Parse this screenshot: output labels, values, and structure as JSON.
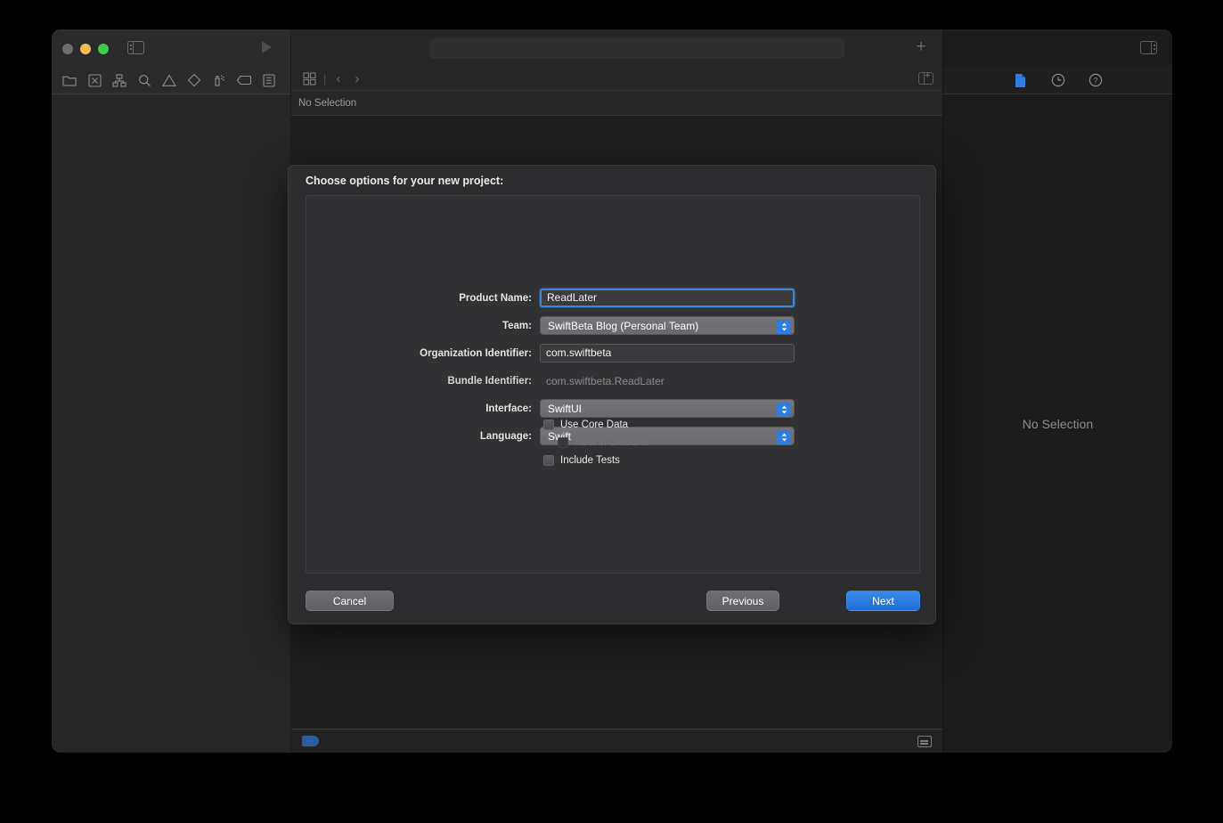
{
  "window": {
    "traffic_lights": [
      "close",
      "minimize",
      "maximize"
    ],
    "sidebar_toggle_icon": "sidebar-toggle-icon",
    "run_button_icon": "run-play-icon",
    "activity_field_value": "",
    "add_button_label": "+",
    "inspector_toggle_icon": "inspector-toggle-icon"
  },
  "navigator": {
    "tabs": [
      {
        "name": "project-navigator",
        "icon": "folder-icon"
      },
      {
        "name": "source-control-navigator",
        "icon": "x-box-icon"
      },
      {
        "name": "symbol-navigator",
        "icon": "hierarchy-icon"
      },
      {
        "name": "find-navigator",
        "icon": "search-icon"
      },
      {
        "name": "issue-navigator",
        "icon": "warning-triangle-icon"
      },
      {
        "name": "test-navigator",
        "icon": "diamond-icon"
      },
      {
        "name": "debug-navigator",
        "icon": "spray-icon"
      },
      {
        "name": "breakpoint-navigator",
        "icon": "tag-icon"
      },
      {
        "name": "report-navigator",
        "icon": "list-icon"
      }
    ]
  },
  "editor": {
    "jumpbar": {
      "grid_icon": "grid-icon",
      "separator": "|",
      "back_chevron": "‹",
      "forward_chevron": "›",
      "add_editor_icon": "add-editor-icon"
    },
    "no_selection_text": "No Selection"
  },
  "status_bar": {
    "tag_icon": "tag-badge-icon",
    "console_icon": "console-toggle-icon"
  },
  "inspector": {
    "tabs": [
      {
        "name": "file-inspector",
        "icon": "document-icon",
        "selected": true
      },
      {
        "name": "history-inspector",
        "icon": "clock-icon",
        "selected": false
      },
      {
        "name": "quick-help-inspector",
        "icon": "question-mark-icon",
        "selected": false
      }
    ],
    "empty_text": "No Selection"
  },
  "dialog": {
    "title": "Choose options for your new project:",
    "fields": [
      {
        "label": "Product Name:",
        "type": "text",
        "value": "ReadLater",
        "focused": true
      },
      {
        "label": "Team:",
        "type": "select",
        "value": "SwiftBeta Blog (Personal Team)"
      },
      {
        "label": "Organization Identifier:",
        "type": "text",
        "value": "com.swiftbeta",
        "focused": false
      },
      {
        "label": "Bundle Identifier:",
        "type": "static",
        "value": "com.swiftbeta.ReadLater"
      },
      {
        "label": "Interface:",
        "type": "select",
        "value": "SwiftUI"
      },
      {
        "label": "Language:",
        "type": "select",
        "value": "Swift"
      }
    ],
    "checkboxes": [
      {
        "label": "Use Core Data",
        "checked": false,
        "enabled": true,
        "indent": false
      },
      {
        "label": "Host in CloudKit",
        "checked": false,
        "enabled": false,
        "indent": true
      },
      {
        "label": "Include Tests",
        "checked": false,
        "enabled": true,
        "indent": false
      }
    ],
    "buttons": {
      "cancel": "Cancel",
      "previous": "Previous",
      "next": "Next"
    }
  },
  "colors": {
    "accent_blue": "#2f7de1",
    "default_button_blue": "#3b8ae8",
    "focus_ring": "#3a87d4",
    "window_bg": "#1e1e1e",
    "sheet_bg": "#2d2d2f"
  }
}
